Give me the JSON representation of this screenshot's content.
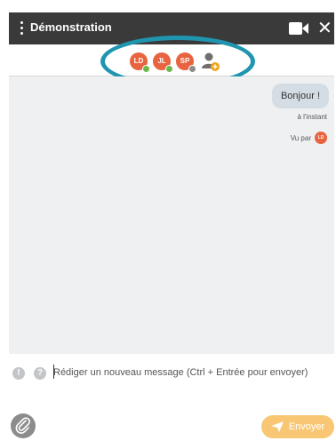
{
  "header": {
    "title": "Démonstration",
    "menu_icon": "kebab-menu-icon",
    "video_icon": "video-camera-icon",
    "close_label": "✕"
  },
  "participants": [
    {
      "initials": "LD",
      "status_color": "#6bb84e"
    },
    {
      "initials": "JL",
      "status_color": "#6bb84e"
    },
    {
      "initials": "SP",
      "status_color": "#8c8c8c"
    }
  ],
  "add_participant_icon": "add-user-icon",
  "messages": [
    {
      "text": "Bonjour !",
      "time": "à l'instant",
      "seen_label": "Vu par",
      "seen_by": "LD"
    }
  ],
  "composer": {
    "placeholder": "Rédiger un nouveau message (Ctrl + Entrée pour envoyer)",
    "info_icons": [
      "!",
      "?"
    ],
    "attach_icon": "paperclip-icon",
    "send_label": "Envoyer",
    "send_icon": "paper-plane-icon"
  },
  "colors": {
    "header_bg": "#3a3a3a",
    "avatar": "#e8633f",
    "highlight": "#1f95b0",
    "send_button": "#f9c774",
    "chat_bg": "#eef0f2"
  }
}
